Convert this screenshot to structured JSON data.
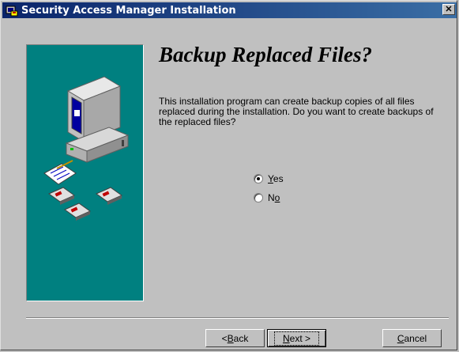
{
  "window": {
    "title": "Security Access Manager Installation",
    "close_label": "✕"
  },
  "page": {
    "heading": "Backup Replaced Files?",
    "description": "This installation program can create backup copies of all files replaced during the installation.  Do you want to create backups of the replaced files?"
  },
  "options": {
    "yes": {
      "label_pre": "",
      "label_ul": "Y",
      "label_post": "es",
      "selected": true
    },
    "no": {
      "label_pre": "N",
      "label_ul": "o",
      "label_post": "",
      "selected": false
    }
  },
  "buttons": {
    "back": {
      "prefix": "< ",
      "ul": "B",
      "rest": "ack"
    },
    "next": {
      "ul": "N",
      "rest": "ext >"
    },
    "cancel": {
      "ul": "C",
      "rest": "ancel"
    }
  },
  "colors": {
    "titlebar_start": "#0a246a",
    "titlebar_end": "#3a6ea5",
    "panel": "#008080",
    "face": "#c0c0c0"
  },
  "icons": [
    "installer-icon",
    "close-icon",
    "computer-icon",
    "notepad-icon",
    "floppy-disk-icon"
  ]
}
